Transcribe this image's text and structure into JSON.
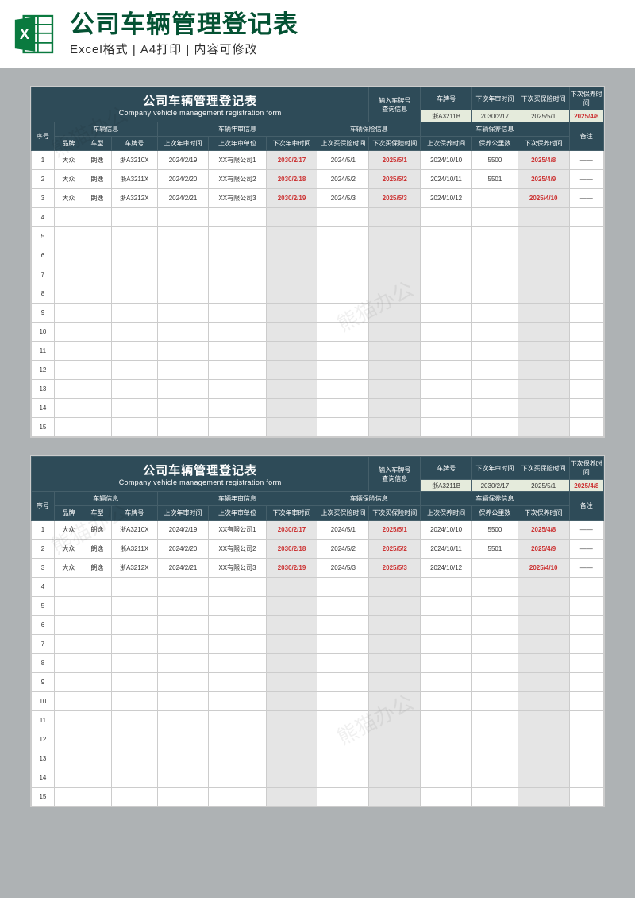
{
  "banner": {
    "title": "公司车辆管理登记表",
    "subtitle": "Excel格式 | A4打印 | 内容可修改"
  },
  "sheet": {
    "title_cn": "公司车辆管理登记表",
    "title_en": "Company vehicle management registration form",
    "lookup_prompt_1": "输入车牌号",
    "lookup_prompt_2": "查询信息",
    "lookup_heads": [
      "车牌号",
      "下次年审时间",
      "下次买保险时间",
      "下次保养时间"
    ],
    "lookup_vals": [
      "浙A3211B",
      "2030/2/17",
      "2025/5/1",
      "2025/4/8"
    ],
    "col_index": "序号",
    "groups": [
      "车辆信息",
      "车辆年审信息",
      "车辆保险信息",
      "车辆保养信息"
    ],
    "col_remark": "备注",
    "cols": [
      "品牌",
      "车型",
      "车牌号",
      "上次年审时间",
      "上次年审单位",
      "下次年审时间",
      "上次买保险时间",
      "下次买保险时间",
      "上次保养时间",
      "保养公里数",
      "下次保养时间"
    ],
    "rows": [
      {
        "idx": "1",
        "brand": "大众",
        "type": "朗逸",
        "plate": "浙A3210X",
        "insp_last": "2024/2/19",
        "insp_unit": "XX有限公司1",
        "insp_next": "2030/2/17",
        "ins_last": "2024/5/1",
        "ins_next": "2025/5/1",
        "maint_last": "2024/10/10",
        "km": "5500",
        "maint_next": "2025/4/8",
        "remark": "——"
      },
      {
        "idx": "2",
        "brand": "大众",
        "type": "朗逸",
        "plate": "浙A3211X",
        "insp_last": "2024/2/20",
        "insp_unit": "XX有限公司2",
        "insp_next": "2030/2/18",
        "ins_last": "2024/5/2",
        "ins_next": "2025/5/2",
        "maint_last": "2024/10/11",
        "km": "5501",
        "maint_next": "2025/4/9",
        "remark": "——"
      },
      {
        "idx": "3",
        "brand": "大众",
        "type": "朗逸",
        "plate": "浙A3212X",
        "insp_last": "2024/2/21",
        "insp_unit": "XX有限公司3",
        "insp_next": "2030/2/19",
        "ins_last": "2024/5/3",
        "ins_next": "2025/5/3",
        "maint_last": "2024/10/12",
        "km": "",
        "maint_next": "2025/4/10",
        "remark": "——"
      }
    ],
    "empty_rows": [
      "4",
      "5",
      "6",
      "7",
      "8",
      "9",
      "10",
      "11",
      "12",
      "13",
      "14",
      "15"
    ]
  },
  "watermark": "熊猫办公"
}
